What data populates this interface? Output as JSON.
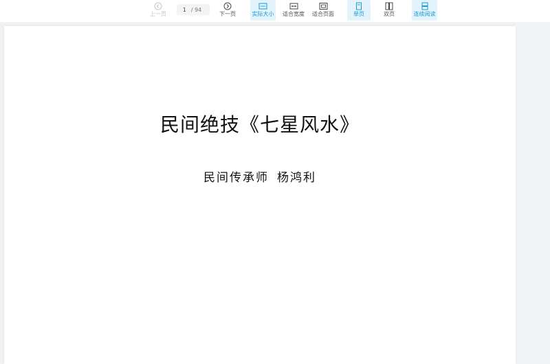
{
  "toolbar": {
    "prev_label": "上一页",
    "page_current": "1",
    "page_total": "/ 94",
    "next_label": "下一页",
    "actual_size_label": "实际大小",
    "fit_width_label": "适合宽度",
    "fit_page_label": "适合页面",
    "single_page_label": "单页",
    "double_page_label": "双页",
    "continuous_label": "连续阅读"
  },
  "document": {
    "title": "民间绝技《七星风水》",
    "author_role": "民间传承师",
    "author_name": "杨鸿利"
  },
  "colors": {
    "accent": "#1a9bd7",
    "active_bg": "#e3f3fb",
    "disabled": "#c4c4c4",
    "background": "#f1f2f4"
  },
  "icons": {
    "prev": "chevron-left-circle-icon",
    "next": "chevron-right-circle-icon",
    "actual_size": "actual-size-icon",
    "fit_width": "fit-width-icon",
    "fit_page": "fit-page-icon",
    "single_page": "single-page-icon",
    "double_page": "double-page-icon",
    "continuous": "continuous-scroll-icon"
  }
}
